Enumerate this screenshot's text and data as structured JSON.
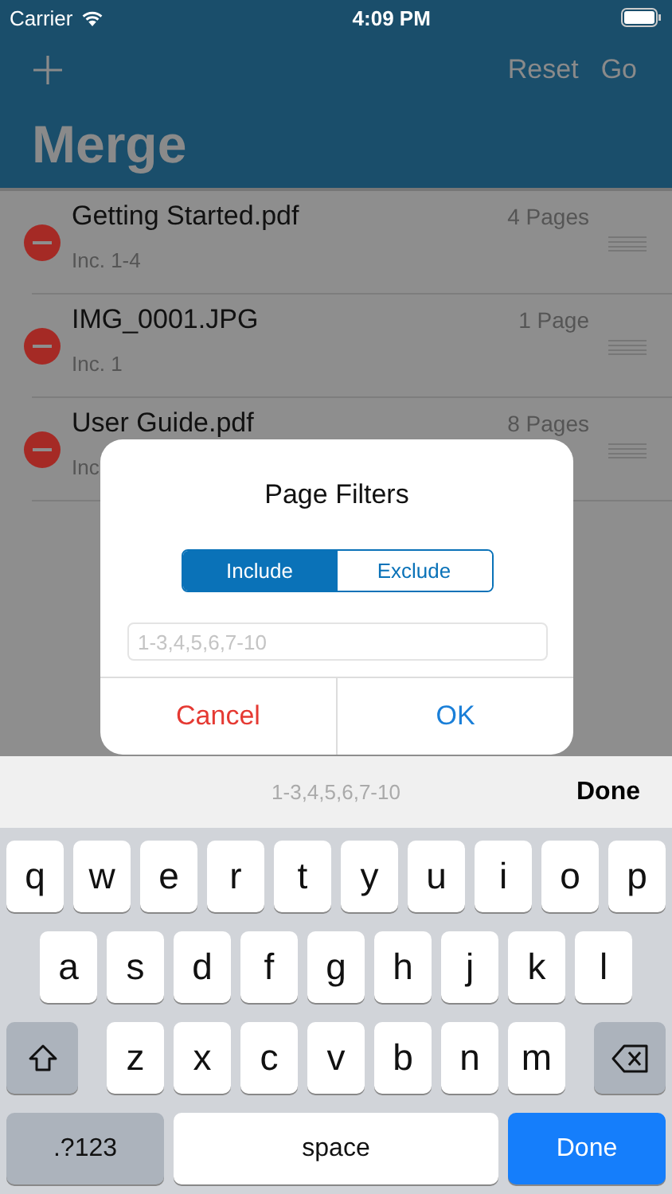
{
  "status_bar": {
    "carrier": "Carrier",
    "time": "4:09 PM"
  },
  "nav": {
    "actions": [
      "Reset",
      "Go"
    ],
    "title": "Merge"
  },
  "files": [
    {
      "name": "Getting Started.pdf",
      "pages": "4 Pages",
      "filter": "Inc. 1-4"
    },
    {
      "name": "IMG_0001.JPG",
      "pages": "1 Page",
      "filter": "Inc. 1"
    },
    {
      "name": "User Guide.pdf",
      "pages": "8 Pages",
      "filter": "Inc"
    }
  ],
  "dialog": {
    "title": "Page Filters",
    "segments": [
      {
        "label": "Include",
        "selected": true
      },
      {
        "label": "Exclude",
        "selected": false
      }
    ],
    "field": {
      "placeholder": "1-3,4,5,6,7-10"
    },
    "cancel": "Cancel",
    "ok": "OK"
  },
  "keyboard": {
    "accessory": {
      "hint": "1-3,4,5,6,7-10",
      "done": "Done"
    },
    "rows": [
      [
        "q",
        "w",
        "e",
        "r",
        "t",
        "y",
        "u",
        "i",
        "o",
        "p"
      ],
      [
        "a",
        "s",
        "d",
        "f",
        "g",
        "h",
        "j",
        "k",
        "l"
      ],
      [
        "z",
        "x",
        "c",
        "v",
        "b",
        "n",
        "m"
      ]
    ],
    "numbers": ".?123",
    "space": "space",
    "done": "Done"
  }
}
